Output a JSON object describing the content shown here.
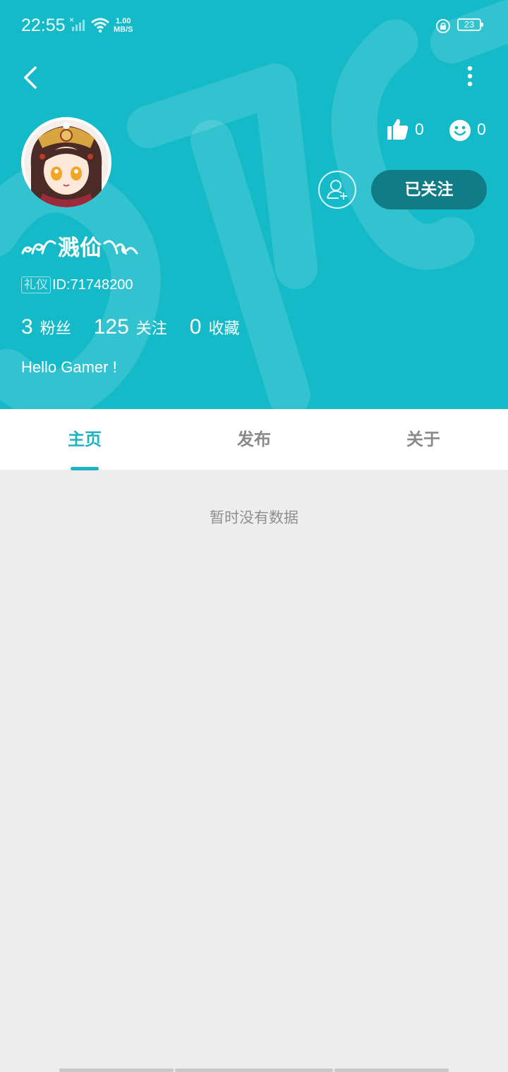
{
  "status_bar": {
    "time": "22:55",
    "net_speed_value": "1.00",
    "net_speed_unit": "MB/S",
    "battery": "23"
  },
  "profile": {
    "nickname": "溅佡",
    "badge": "礼仪",
    "id_text": "ID:71748200",
    "like_count": "0",
    "smile_count": "0",
    "follow_button": "已关注",
    "bio": "Hello Gamer !",
    "stats": {
      "fans_count": "3",
      "fans_label": "粉丝",
      "following_count": "125",
      "following_label": "关注",
      "favorites_count": "0",
      "favorites_label": "收藏"
    }
  },
  "tabs": [
    {
      "label": "主页",
      "active": true
    },
    {
      "label": "发布",
      "active": false
    },
    {
      "label": "关于",
      "active": false
    }
  ],
  "empty_state": "暂时没有数据",
  "colors": {
    "header_bg": "#15bac9",
    "accent": "#1fb3c2",
    "follow_button_bg": "#107d86",
    "content_bg": "#ededed"
  }
}
